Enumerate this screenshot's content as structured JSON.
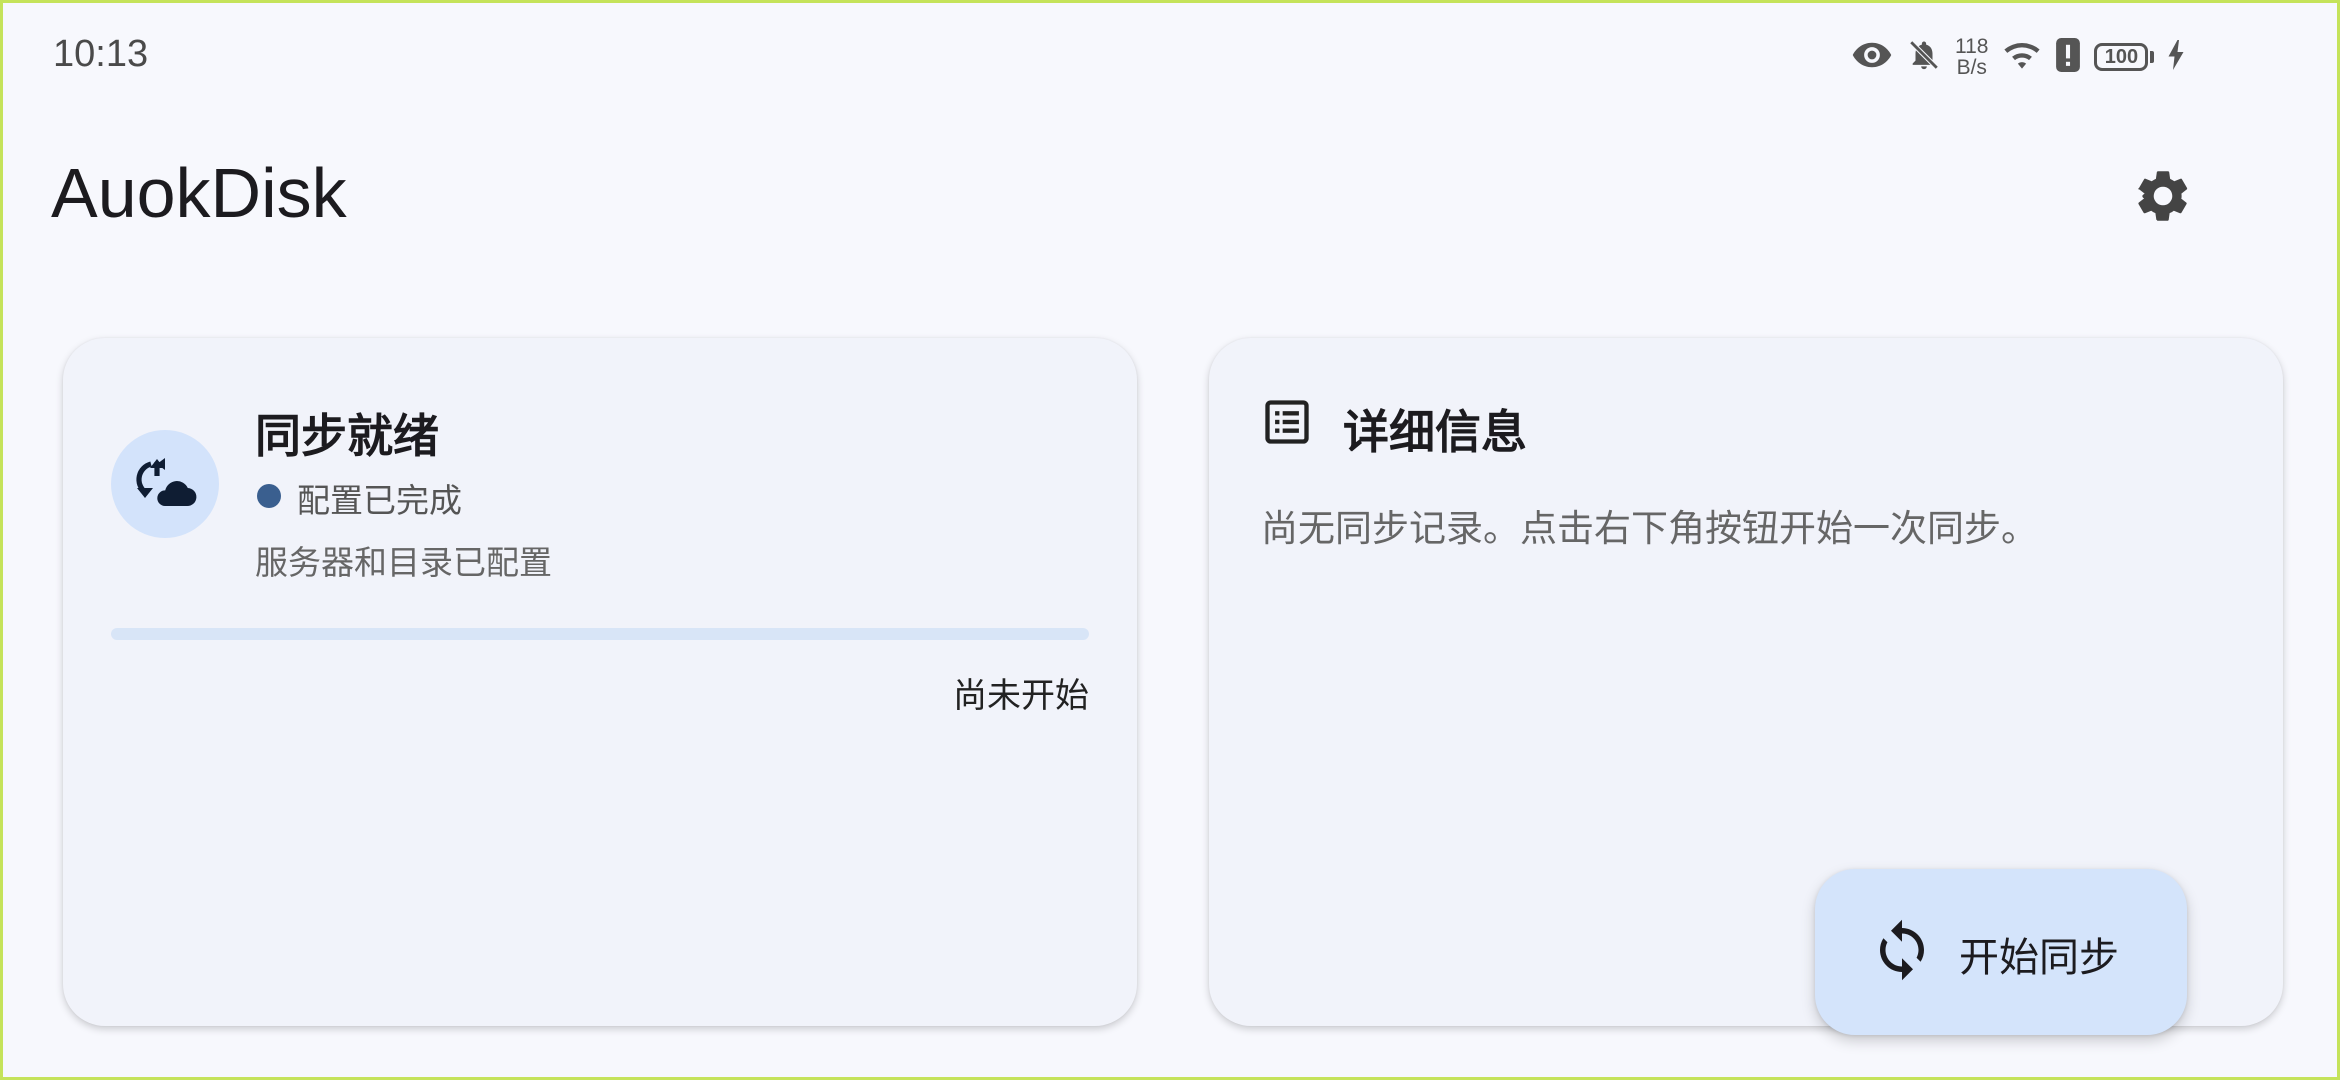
{
  "status_bar": {
    "time": "10:13",
    "net_speed_value": "118",
    "net_speed_unit": "B/s",
    "battery": "100",
    "icons": [
      "eye-icon",
      "bell-off-icon",
      "wifi-icon",
      "alert-icon",
      "battery-icon",
      "charging-icon"
    ]
  },
  "app": {
    "title": "AuokDisk",
    "settings_icon": "gear-icon"
  },
  "sync_card": {
    "icon": "sync-cloud-icon",
    "title": "同步就绪",
    "status": "配置已完成",
    "status_color": "#3a5f8f",
    "description": "服务器和目录已配置",
    "progress": 0,
    "progress_label": "尚未开始"
  },
  "details_card": {
    "icon": "list-icon",
    "title": "详细信息",
    "body": "尚无同步记录。点击右下角按钮开始一次同步。"
  },
  "fab": {
    "icon": "sync-icon",
    "label": "开始同步"
  },
  "colors": {
    "background": "#f7f8fd",
    "card": "#f1f3fa",
    "accent_light": "#d4e4fb",
    "accent": "#3a5f8f"
  }
}
